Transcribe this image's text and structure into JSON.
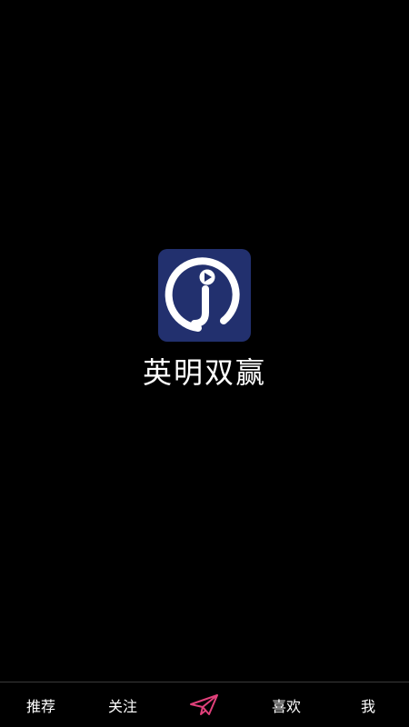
{
  "app": {
    "name": "英明双赢",
    "logo_icon": "j-play-logo-icon",
    "logo_bg_color": "#22306e"
  },
  "tabbar": {
    "tabs": [
      {
        "label": "推荐"
      },
      {
        "label": "关注"
      },
      {
        "label": "",
        "icon": "paper-plane-icon",
        "icon_color": "#e0407a"
      },
      {
        "label": "喜欢"
      },
      {
        "label": "我"
      }
    ]
  }
}
